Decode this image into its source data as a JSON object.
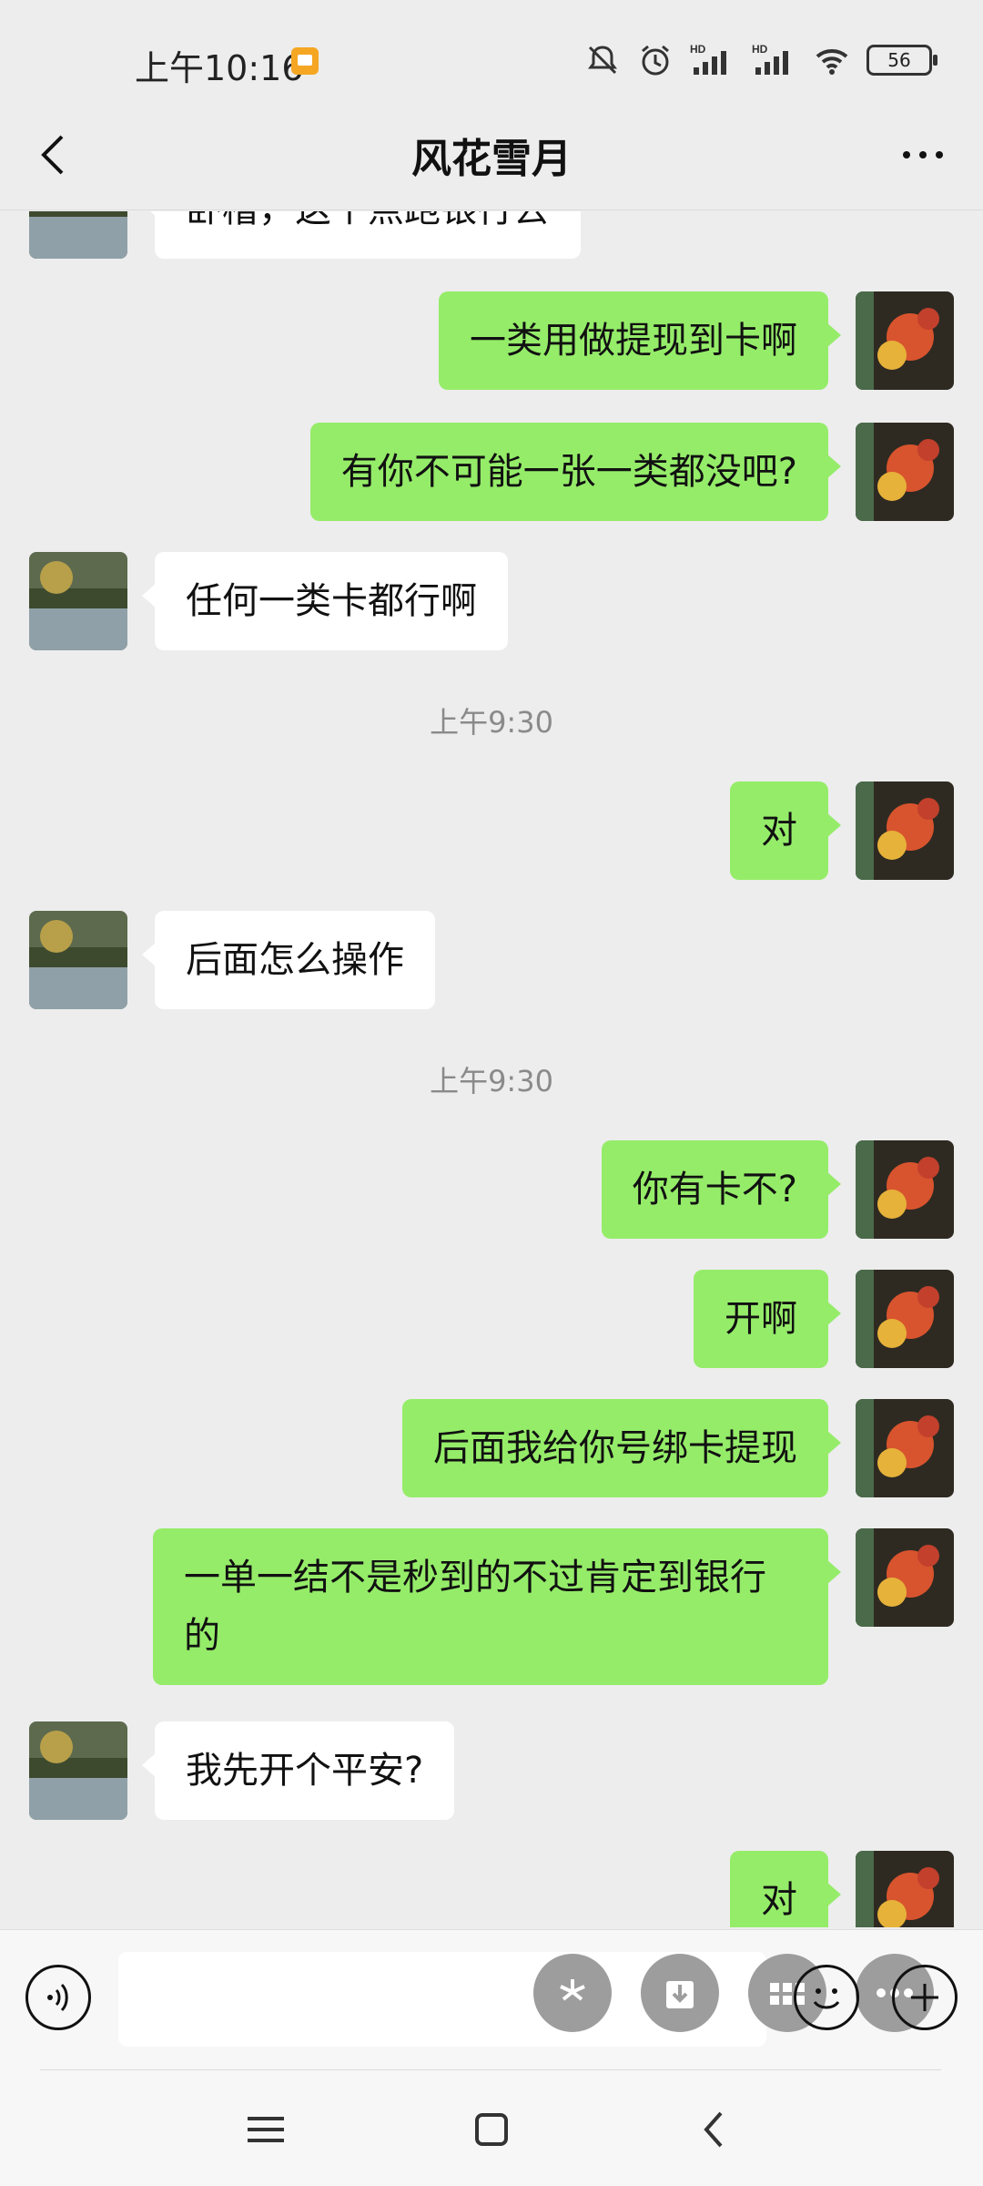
{
  "status_bar": {
    "time": "上午10:16",
    "battery": "56"
  },
  "header": {
    "title": "风花雪月"
  },
  "messages": [
    {
      "side": "left",
      "text": "卧槽，这个点跑银行去"
    },
    {
      "side": "right",
      "text": "一类用做提现到卡啊"
    },
    {
      "side": "right",
      "text": "有你不可能一张一类都没吧?"
    },
    {
      "side": "left",
      "text": "任何一类卡都行啊"
    },
    {
      "type": "time",
      "text": "上午9:30"
    },
    {
      "side": "right",
      "text": "对"
    },
    {
      "side": "left",
      "text": "后面怎么操作"
    },
    {
      "type": "time",
      "text": "上午9:30"
    },
    {
      "side": "right",
      "text": "你有卡不?"
    },
    {
      "side": "right",
      "text": "开啊"
    },
    {
      "side": "right",
      "text": "后面我给你号绑卡提现"
    },
    {
      "side": "right",
      "text": "一单一结不是秒到的不过肯定到银行的"
    },
    {
      "side": "left",
      "text": "我先开个平安?"
    },
    {
      "side": "right",
      "text": "对"
    }
  ],
  "colors": {
    "background": "#ededed",
    "bubble_self": "#95ec69",
    "bubble_other": "#ffffff",
    "timestamp": "#8a8a8a"
  },
  "icons": {
    "back": "chevron-left-icon",
    "more": "more-dots-icon",
    "voice": "voice-icon",
    "emoji": "emoji-icon",
    "plus": "plus-icon"
  }
}
